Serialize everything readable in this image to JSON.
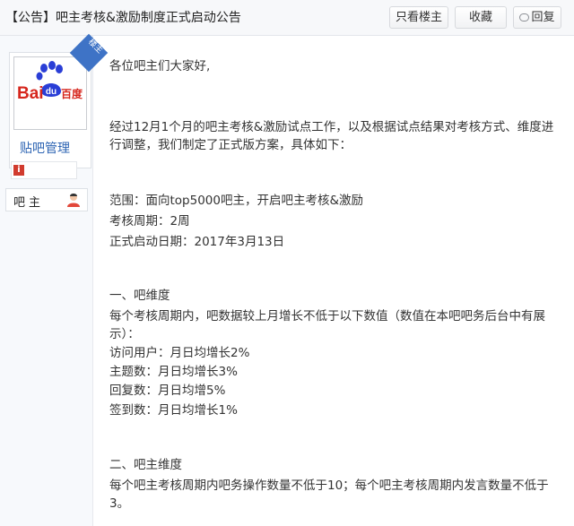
{
  "header": {
    "title": "【公告】吧主考核&激励制度正式启动公告",
    "btn_only_lz": "只看楼主",
    "btn_collect": "收藏",
    "btn_reply": "回复"
  },
  "author": {
    "lz_badge": "楼主",
    "name": "贴吧管理",
    "role": "吧主",
    "logo": {
      "left": "Bai",
      "right": "百度"
    }
  },
  "post": {
    "greeting": "各位吧主们大家好,",
    "intro": "经过12月1个月的吧主考核&激励试点工作，以及根据试点结果对考核方式、维度进行调整，我们制定了正式版方案，具体如下：",
    "scope": "范围：面向top5000吧主，开启吧主考核&激励",
    "cycle": "考核周期：2周",
    "start_date": "正式启动日期：2017年3月13日",
    "sec1_title": "一、吧维度",
    "sec1_desc": "每个考核周期内，吧数据较上月增长不低于以下数值（数值在本吧吧务后台中有展示）：",
    "sec1_items": [
      "访问用户：月日均增长2%",
      "主题数：月日均增长3%",
      "回复数：月日均增5%",
      "签到数：月日均增长1%"
    ],
    "sec2_title": "二、吧主维度",
    "sec2_desc": "每个吧主考核周期内吧务操作数量不低于10；每个吧主考核周期内发言数量不低于3。"
  },
  "colors": {
    "link_blue": "#2d64b3",
    "badge_blue": "#3e73c6",
    "logo_red": "#d6261d",
    "logo_blue": "#2a3ed6"
  }
}
